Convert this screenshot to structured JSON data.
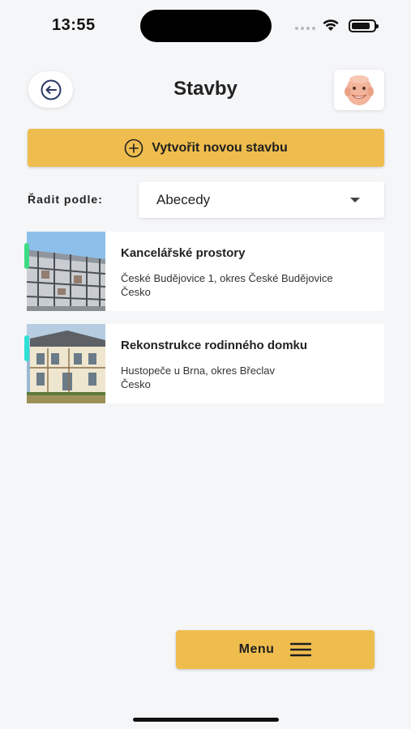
{
  "status_bar": {
    "time": "13:55"
  },
  "header": {
    "title": "Stavby"
  },
  "actions": {
    "create_label": "Vytvořit novou stavbu"
  },
  "sort": {
    "label": "Řadit podle:",
    "selected": "Abecedy"
  },
  "projects": [
    {
      "title": "Kancelářské prostory",
      "address_line1": "České Budějovice 1, okres České Budějovice",
      "address_line2": "Česko",
      "status_color": "#3ddc84"
    },
    {
      "title": "Rekonstrukce rodinného domku",
      "address_line1": "Hustopeče u Brna, okres Břeclav",
      "address_line2": "Česko",
      "status_color": "#2ee0d6"
    }
  ],
  "footer": {
    "menu_label": "Menu"
  },
  "colors": {
    "accent": "#efbd4e",
    "background": "#f5f6f8"
  }
}
